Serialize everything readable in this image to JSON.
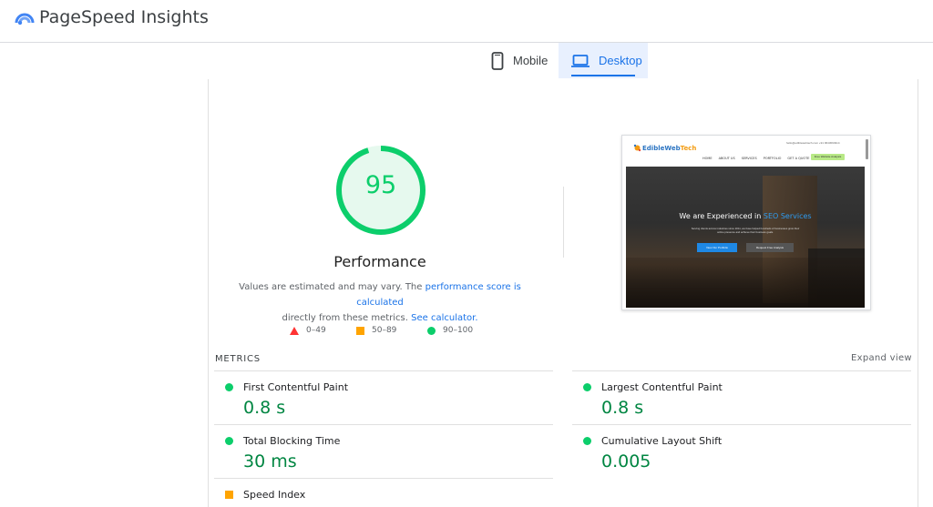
{
  "app": {
    "title": "PageSpeed Insights"
  },
  "tabs": [
    {
      "label": "Mobile",
      "icon": "phone-icon",
      "active": false
    },
    {
      "label": "Desktop",
      "icon": "laptop-icon",
      "active": true
    }
  ],
  "performance": {
    "score": 95,
    "title": "Performance",
    "desc_prefix": "Values are estimated and may vary. The ",
    "desc_link1": "performance score is calculated",
    "desc_middle": "directly from these metrics. ",
    "desc_link2": "See calculator."
  },
  "legend": [
    {
      "range": "0–49",
      "shape": "triangle",
      "color": "#ff3333"
    },
    {
      "range": "50–89",
      "shape": "square",
      "color": "#ffa400"
    },
    {
      "range": "90–100",
      "shape": "circle",
      "color": "#0cce6b"
    }
  ],
  "screenshot": {
    "logo_main": "EdibleWeb",
    "logo_accent": "Tech",
    "contact": "hello@ediblewebtech.com    +91 9643094914",
    "nav": [
      "HOME",
      "ABOUT US",
      "SERVICES",
      "PORTFOLIO",
      "GET A QUOTE"
    ],
    "cta": "Free Website Analysis",
    "headline_prefix": "We are Experienced in ",
    "headline_accent": "SEO Services",
    "subtext": "Serving clients across industries since 2011, we have helped hundreds of businesses grow their online presence and achieve their business goals.",
    "button_primary": "View Our Portfolio",
    "button_secondary": "Request Free Analysis"
  },
  "metrics": {
    "label": "METRICS",
    "expand_label": "Expand view",
    "items": [
      {
        "name": "First Contentful Paint",
        "value": "0.8 s",
        "status": "good"
      },
      {
        "name": "Largest Contentful Paint",
        "value": "0.8 s",
        "status": "good"
      },
      {
        "name": "Total Blocking Time",
        "value": "30 ms",
        "status": "good"
      },
      {
        "name": "Cumulative Layout Shift",
        "value": "0.005",
        "status": "good"
      },
      {
        "name": "Speed Index",
        "value": "",
        "status": "average"
      }
    ]
  },
  "colors": {
    "good": "#0cce6b",
    "average": "#ffa400",
    "poor": "#ff3333",
    "accent": "#1a73e8"
  }
}
